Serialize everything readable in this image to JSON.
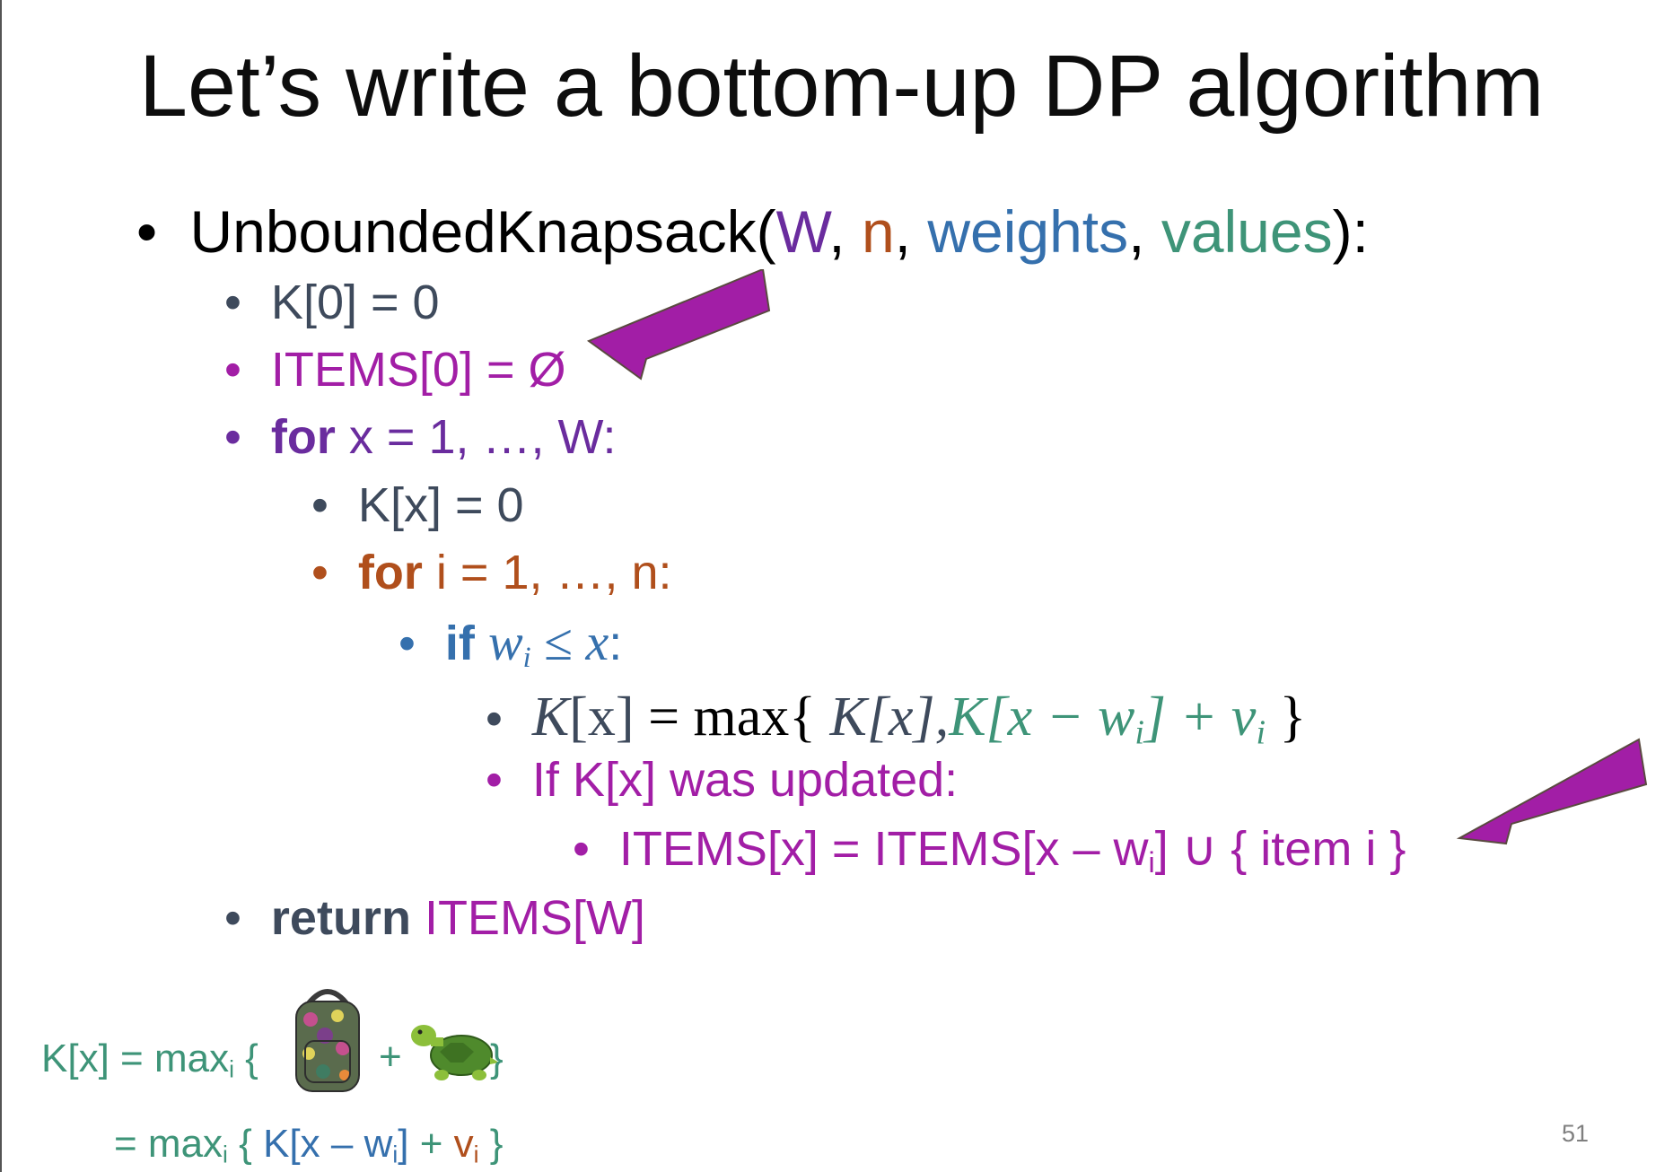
{
  "slide": {
    "title": "Let’s write a bottom-up DP algorithm",
    "page_number": "51",
    "bullet_glyph": "•"
  },
  "code": {
    "header": {
      "name": "UnboundedKnapsack(",
      "arg_W": "W",
      "arg_n": "n",
      "arg_weights": "weights",
      "arg_values": "values",
      "comma": ",",
      "close": "):"
    },
    "k0": "K[0] = 0",
    "items0": "ITEMS[0] = Ø",
    "for_x_kw": "for",
    "for_x_rest": " x = 1, …, W:",
    "kx_init": "K[x] = 0",
    "for_i_kw": "for",
    "for_i_rest": " i = 1, …, n:",
    "if_kw": "if",
    "if_w": "w",
    "if_sub": "i",
    "if_leq": " ≤ ",
    "if_x": "x",
    "if_colon": ":",
    "upd_lhs": "K",
    "upd_lhs_arg": "[x]",
    "upd_eq": " = max{ ",
    "upd_term1": "K[x],",
    "upd_term2_a": "K[x − w",
    "upd_term2_sub": "i",
    "upd_term2_b": "] + v",
    "upd_term2_sub2": "i",
    "upd_close": " }",
    "if_updated": "If K[x] was updated:",
    "items_update_a": "ITEMS[x] = ITEMS[x – w",
    "items_update_sub": "i",
    "items_update_b": "] ∪ { item i }",
    "return_kw": "return",
    "return_rest": " ITEMS[W]"
  },
  "recurrence": {
    "line1_a": "K[x] = max",
    "line1_sub": "i",
    "line1_b": " {",
    "plus": "+",
    "close": "}",
    "line2_a": "= max",
    "line2_sub": "i",
    "line2_b": " { ",
    "line2_k": "K[x – w",
    "line2_ksub": "i",
    "line2_k2": "]",
    "line2_plus": " + ",
    "line2_v": "v",
    "line2_vsub": "i",
    "line2_close": " }"
  },
  "colors": {
    "magenta": "#a21ea6",
    "purple": "#6a2c9e",
    "orange": "#b04f1c",
    "blue": "#3570ad",
    "green": "#3e9478",
    "gray": "#3e4a5c"
  },
  "icons": {
    "arrow": "callout-arrow-icon",
    "backpack": "backpack-icon",
    "turtle": "turtle-icon"
  }
}
